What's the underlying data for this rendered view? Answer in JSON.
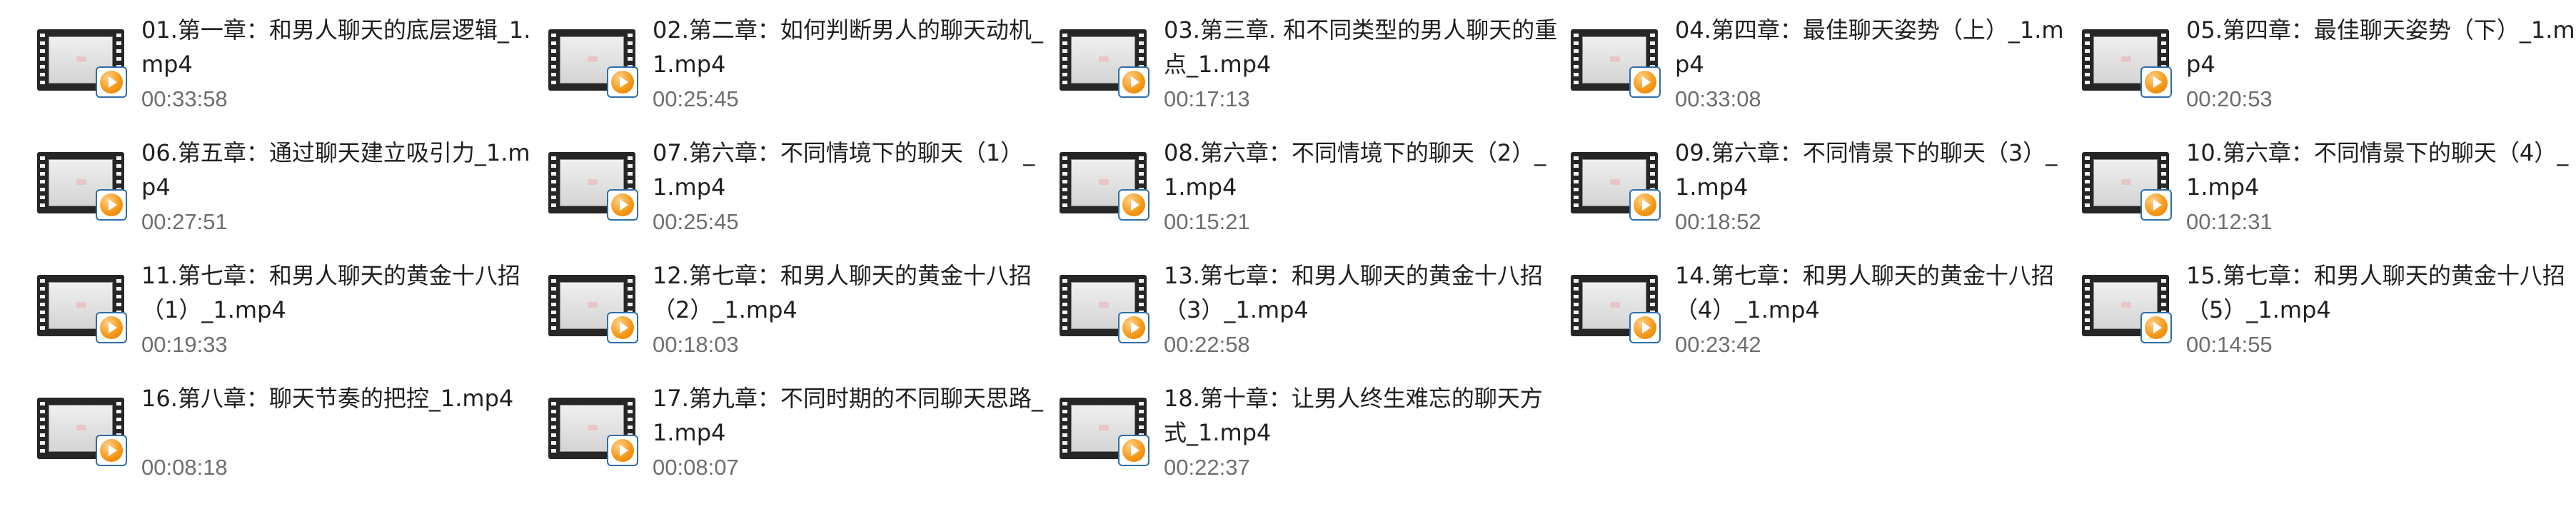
{
  "view": "file-explorer-tiles",
  "icons": {
    "file_thumbnail": "video-file-icon",
    "overlay": "play-icon",
    "overlay_color": "#f59a1a",
    "badge_border": "#2f6ea8"
  },
  "files": [
    {
      "name": "01.第一章：和男人聊天的底层逻辑_1.mp4",
      "duration": "00:33:58"
    },
    {
      "name": "02.第二章：如何判断男人的聊天动机_1.mp4",
      "duration": "00:25:45"
    },
    {
      "name": "03.第三章. 和不同类型的男人聊天的重点_1.mp4",
      "duration": "00:17:13"
    },
    {
      "name": "04.第四章：最佳聊天姿势（上）_1.mp4",
      "duration": "00:33:08"
    },
    {
      "name": "05.第四章：最佳聊天姿势（下）_1.mp4",
      "duration": "00:20:53"
    },
    {
      "name": "06.第五章：通过聊天建立吸引力_1.mp4",
      "duration": "00:27:51"
    },
    {
      "name": "07.第六章：不同情境下的聊天（1）_1.mp4",
      "duration": "00:25:45"
    },
    {
      "name": "08.第六章：不同情境下的聊天（2）_1.mp4",
      "duration": "00:15:21"
    },
    {
      "name": "09.第六章：不同情景下的聊天（3）_1.mp4",
      "duration": "00:18:52"
    },
    {
      "name": "10.第六章：不同情景下的聊天（4）_1.mp4",
      "duration": "00:12:31"
    },
    {
      "name": "11.第七章：和男人聊天的黄金十八招（1）_1.mp4",
      "duration": "00:19:33"
    },
    {
      "name": "12.第七章：和男人聊天的黄金十八招（2）_1.mp4",
      "duration": "00:18:03"
    },
    {
      "name": "13.第七章：和男人聊天的黄金十八招（3）_1.mp4",
      "duration": "00:22:58"
    },
    {
      "name": "14.第七章：和男人聊天的黄金十八招（4）_1.mp4",
      "duration": "00:23:42"
    },
    {
      "name": "15.第七章：和男人聊天的黄金十八招（5）_1.mp4",
      "duration": "00:14:55"
    },
    {
      "name": "16.第八章：聊天节奏的把控_1.mp4",
      "duration": "00:08:18"
    },
    {
      "name": "17.第九章：不同时期的不同聊天思路_1.mp4",
      "duration": "00:08:07"
    },
    {
      "name": "18.第十章：让男人终生难忘的聊天方式_1.mp4",
      "duration": "00:22:37"
    }
  ]
}
